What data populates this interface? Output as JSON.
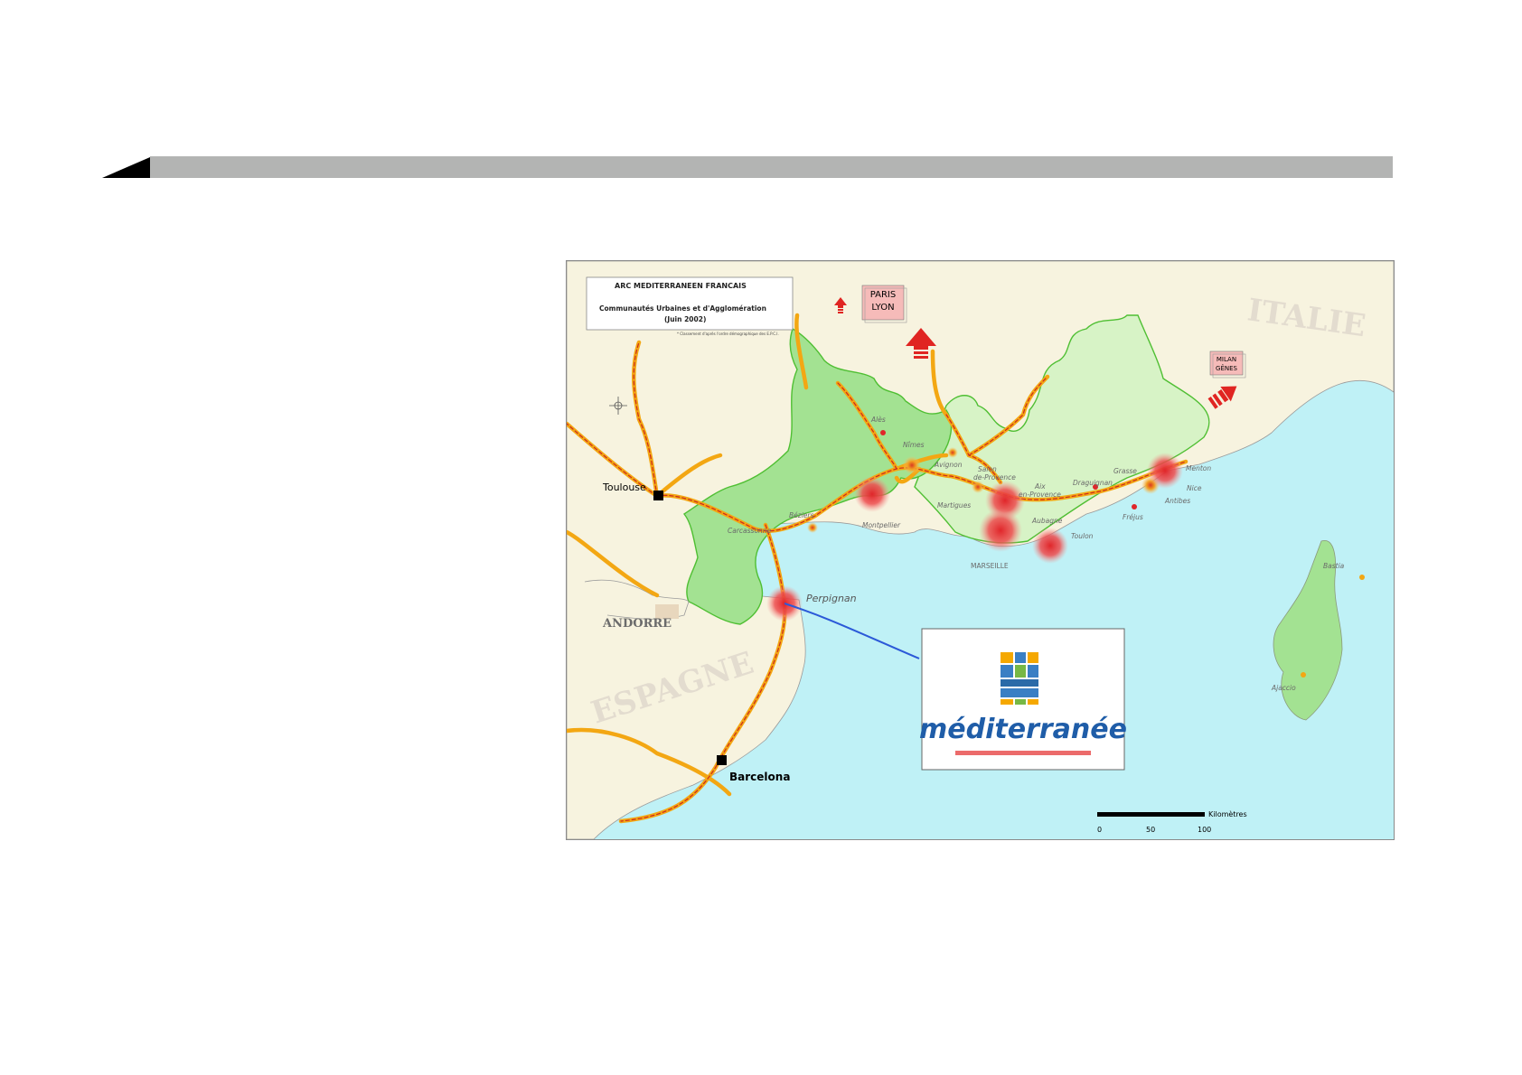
{
  "legend": {
    "title": "ARC MEDITERRANEEN FRANCAIS",
    "line1": "Communautés Urbaines et d'Agglomération",
    "line2": "(Juin 2002)",
    "footnote": "* Classement d'après l'ordre démographique des E.P.C.I."
  },
  "countries": {
    "italie": "ITALIE",
    "espagne": "ESPAGNE",
    "andorre": "ANDORRE"
  },
  "major_cities": {
    "toulouse": "Toulouse",
    "barcelona": "Barcelona",
    "perpignan": "Perpignan"
  },
  "cities": {
    "ales": "Alès",
    "nimes": "Nîmes",
    "avignon": "Avignon",
    "salon": "Salon",
    "de_provence": "de-Provence",
    "aix": "Aix",
    "en_provence": "en-Provence",
    "draguignan": "Draguignan",
    "grasse": "Grasse",
    "menton": "Menton",
    "nice": "Nice",
    "antibes": "Antibes",
    "frejus": "Fréjus",
    "beziers": "Béziers",
    "carcassonne": "Carcassonne",
    "montpellier": "Montpellier",
    "martigues": "Martigues",
    "aubagne": "Aubagne",
    "toulon": "Toulon",
    "marseille": "MARSEILLE",
    "bastia": "Bastia",
    "ajaccio": "Ajaccio"
  },
  "directions": {
    "paris_lyon_1": "PARIS",
    "paris_lyon_2": "LYON",
    "milan_genes_1": "MILAN",
    "milan_genes_2": "GÊNES"
  },
  "logo": {
    "brand": "méditerranée"
  },
  "scale": {
    "unit": "Kilomètres",
    "ticks": [
      "0",
      "50",
      "100"
    ]
  },
  "colors": {
    "sea": "#bff1f6",
    "land": "#f7f3df",
    "region_dark": "#a3e292",
    "region_light": "#d7f3c6",
    "road_outer": "#f3a713",
    "road_inner": "#cc2a1e",
    "hub": "#e0262a",
    "arrow": "#e02522",
    "callout_line": "#2b59d8",
    "header_bar": "#b3b4b3"
  }
}
